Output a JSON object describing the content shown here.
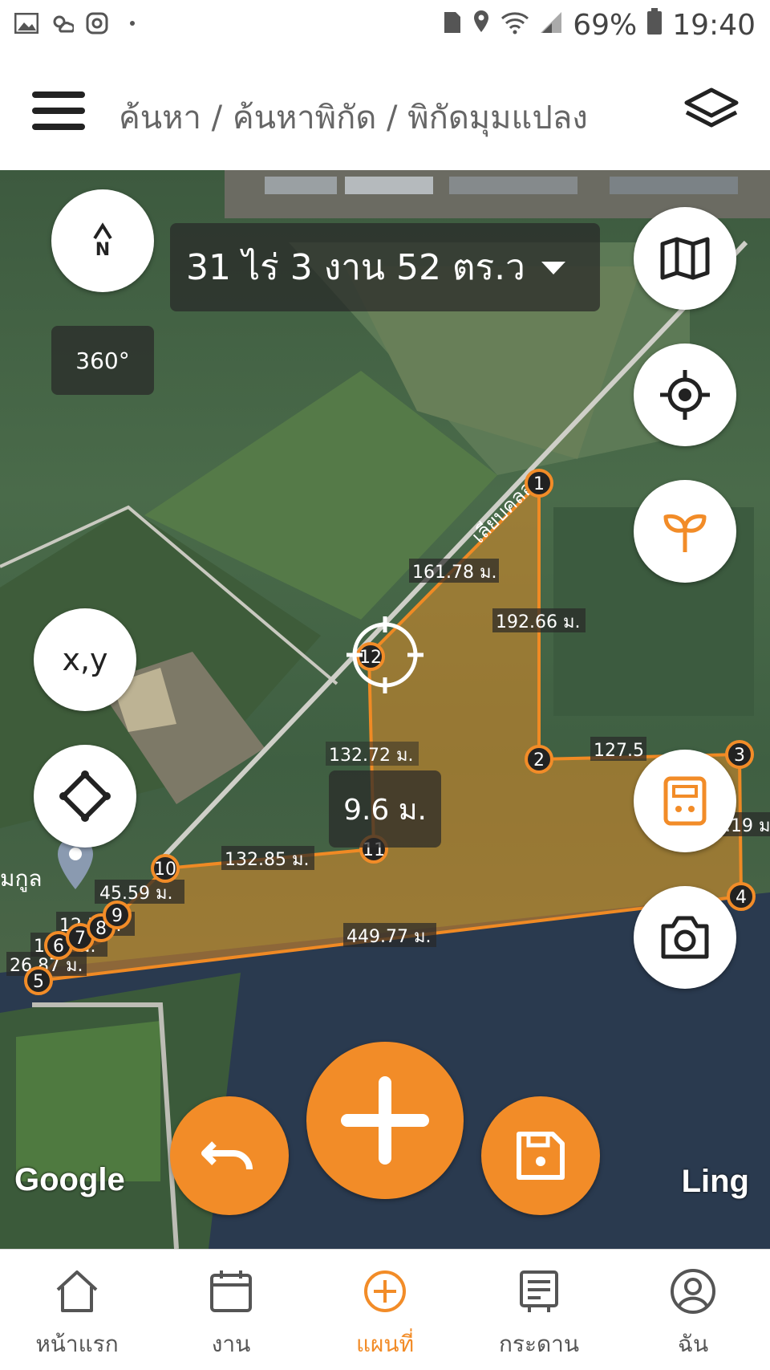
{
  "status": {
    "battery": "69%",
    "time": "19:40"
  },
  "header": {
    "breadcrumb": "ค้นหา / ค้นหาพิกัด / พิกัดมุมแปลง"
  },
  "map": {
    "area_label": "31 ไร่ 3 งาน 52 ตร.ว",
    "compass": "N",
    "rotate_label": "360°",
    "xy_label": "x,y",
    "segment_length": "9.6 ม.",
    "road_label": "เลียบคลอง",
    "place_label": "มกูล",
    "google": "Google",
    "watermark": "Ling",
    "edges": [
      "161.78 ม.",
      "192.66 ม.",
      "127.5",
      "8.19 ม",
      "449.77 ม.",
      "26.87 ม.",
      "15.9 ม.",
      "12.5 ม.",
      "12 ม.",
      "45.59 ม.",
      "132.85 ม.",
      "132.72 ม."
    ],
    "points": [
      "1",
      "2",
      "3",
      "4",
      "5",
      "6",
      "7",
      "8",
      "9",
      "10",
      "11",
      "12"
    ]
  },
  "nav": [
    {
      "label": "หน้าแรก"
    },
    {
      "label": "งาน"
    },
    {
      "label": "แผนที่"
    },
    {
      "label": "กระดาน"
    },
    {
      "label": "ฉัน"
    }
  ],
  "colors": {
    "accent": "#f28c28"
  }
}
